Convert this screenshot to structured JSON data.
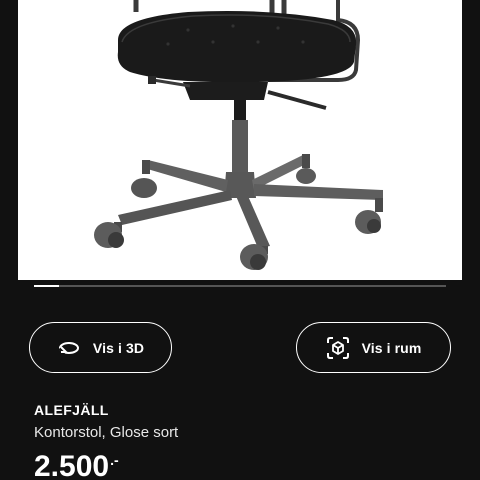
{
  "product": {
    "name": "ALEFJÄLL",
    "description": "Kontorstol, Glose sort",
    "price": "2.500",
    "price_suffix": ".-"
  },
  "gallery": {
    "image_icon": "office-chair-image",
    "progress": 0.06
  },
  "actions": {
    "view_3d": {
      "label": "Vis i 3D",
      "icon": "rotate-3d-icon"
    },
    "view_in_room": {
      "label": "Vis i rum",
      "icon": "ar-cube-icon"
    }
  },
  "colors": {
    "background": "#111111",
    "image_background": "#ffffff",
    "text": "#ffffff"
  }
}
